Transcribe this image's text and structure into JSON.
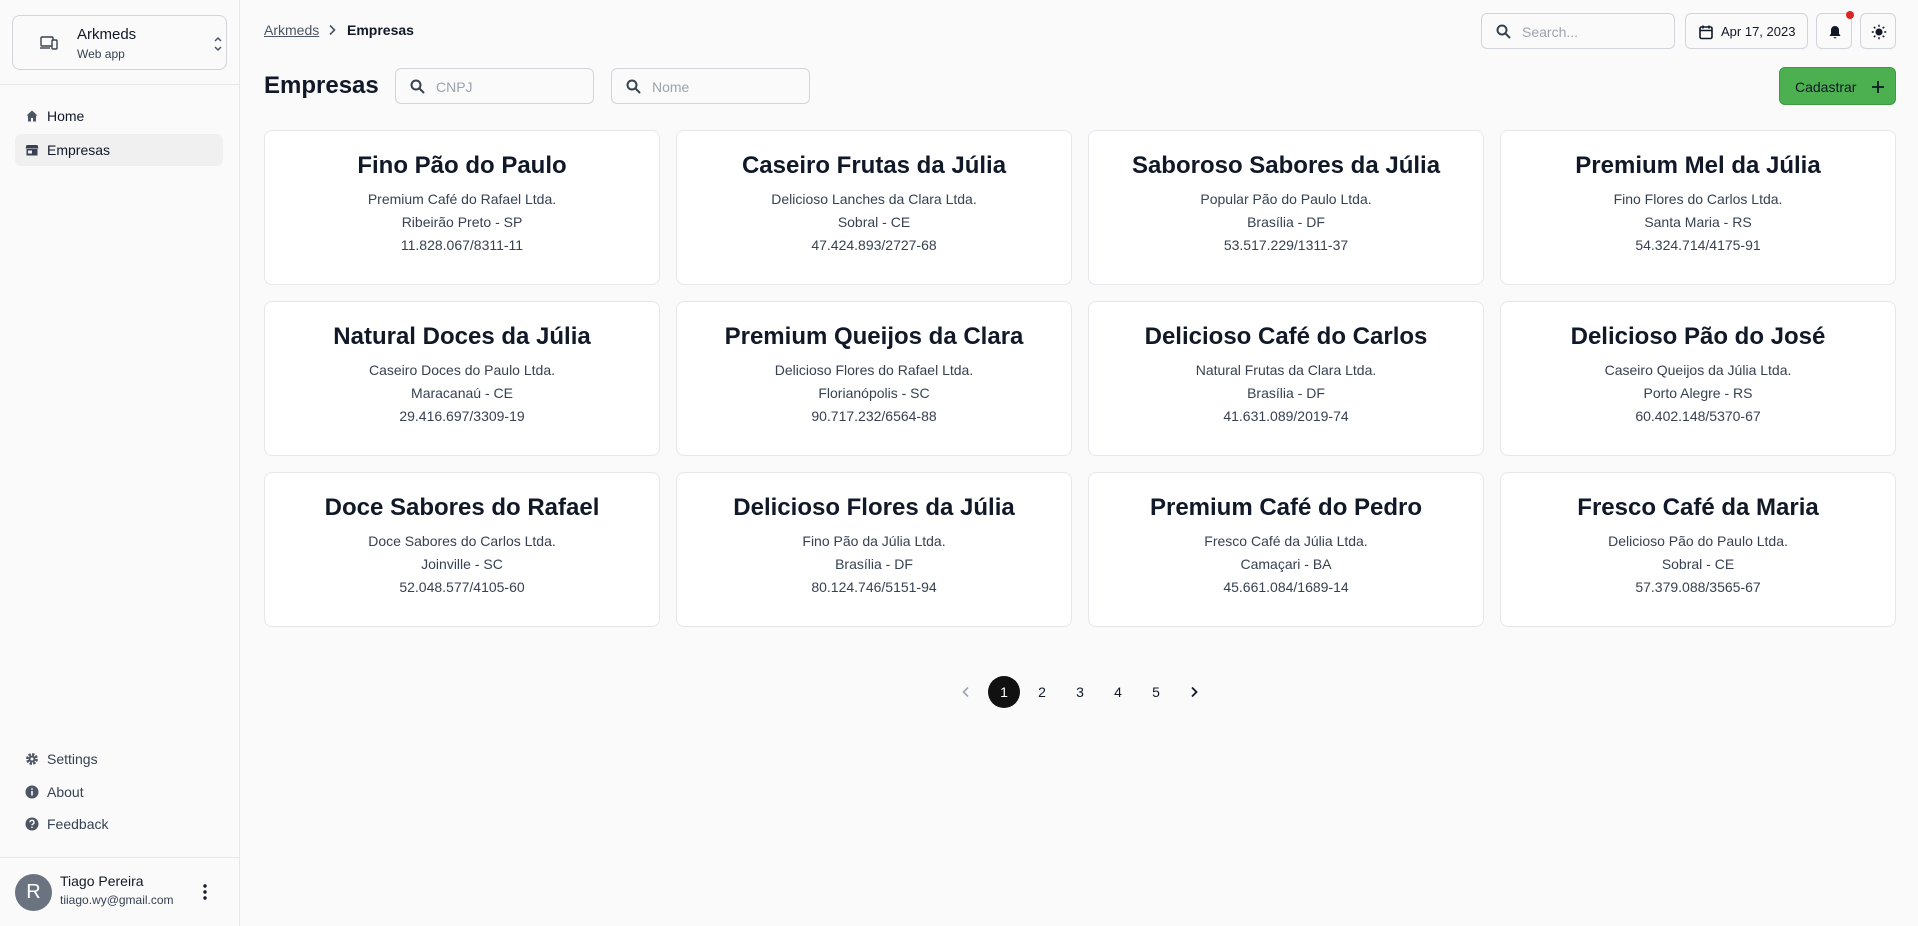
{
  "app_switcher": {
    "name": "Arkmeds",
    "subtitle": "Web app"
  },
  "sidebar": {
    "nav": [
      {
        "label": "Home",
        "icon": "home-icon",
        "active": false
      },
      {
        "label": "Empresas",
        "icon": "store-icon",
        "active": true
      }
    ],
    "bottom": [
      {
        "label": "Settings",
        "icon": "gear-icon"
      },
      {
        "label": "About",
        "icon": "info-icon"
      },
      {
        "label": "Feedback",
        "icon": "help-icon"
      }
    ]
  },
  "user": {
    "initial": "R",
    "name": "Tiago Pereira",
    "email": "tiiago.wy@gmail.com"
  },
  "header": {
    "breadcrumb": {
      "root": "Arkmeds",
      "current": "Empresas"
    },
    "search_placeholder": "Search...",
    "date_label": "Apr 17, 2023",
    "has_notification": true
  },
  "page": {
    "title": "Empresas",
    "filter_cnpj_placeholder": "CNPJ",
    "filter_nome_placeholder": "Nome",
    "add_button": "Cadastrar"
  },
  "companies": [
    {
      "name": "Fino Pão do Paulo",
      "legal_name": "Premium Café do Rafael Ltda.",
      "city": "Ribeirão Preto - SP",
      "cnpj": "11.828.067/8311-11"
    },
    {
      "name": "Caseiro Frutas da Júlia",
      "legal_name": "Delicioso Lanches da Clara Ltda.",
      "city": "Sobral - CE",
      "cnpj": "47.424.893/2727-68"
    },
    {
      "name": "Saboroso Sabores da Júlia",
      "legal_name": "Popular Pão do Paulo Ltda.",
      "city": "Brasília - DF",
      "cnpj": "53.517.229/1311-37"
    },
    {
      "name": "Premium Mel da Júlia",
      "legal_name": "Fino Flores do Carlos Ltda.",
      "city": "Santa Maria - RS",
      "cnpj": "54.324.714/4175-91"
    },
    {
      "name": "Natural Doces da Júlia",
      "legal_name": "Caseiro Doces do Paulo Ltda.",
      "city": "Maracanaú - CE",
      "cnpj": "29.416.697/3309-19"
    },
    {
      "name": "Premium Queijos da Clara",
      "legal_name": "Delicioso Flores do Rafael Ltda.",
      "city": "Florianópolis - SC",
      "cnpj": "90.717.232/6564-88"
    },
    {
      "name": "Delicioso Café do Carlos",
      "legal_name": "Natural Frutas da Clara Ltda.",
      "city": "Brasília - DF",
      "cnpj": "41.631.089/2019-74"
    },
    {
      "name": "Delicioso Pão do José",
      "legal_name": "Caseiro Queijos da Júlia Ltda.",
      "city": "Porto Alegre - RS",
      "cnpj": "60.402.148/5370-67"
    },
    {
      "name": "Doce Sabores do Rafael",
      "legal_name": "Doce Sabores do Carlos Ltda.",
      "city": "Joinville - SC",
      "cnpj": "52.048.577/4105-60"
    },
    {
      "name": "Delicioso Flores da Júlia",
      "legal_name": "Fino Pão da Júlia Ltda.",
      "city": "Brasília - DF",
      "cnpj": "80.124.746/5151-94"
    },
    {
      "name": "Premium Café do Pedro",
      "legal_name": "Fresco Café da Júlia Ltda.",
      "city": "Camaçari - BA",
      "cnpj": "45.661.084/1689-14"
    },
    {
      "name": "Fresco Café da Maria",
      "legal_name": "Delicioso Pão do Paulo Ltda.",
      "city": "Sobral - CE",
      "cnpj": "57.379.088/3565-67"
    }
  ],
  "pagination": {
    "pages": [
      "1",
      "2",
      "3",
      "4",
      "5"
    ],
    "current": "1"
  },
  "colors": {
    "primary_button": "#4caf50",
    "active_page": "#111111",
    "notification_dot": "#dc2626",
    "background": "#fafafa"
  }
}
